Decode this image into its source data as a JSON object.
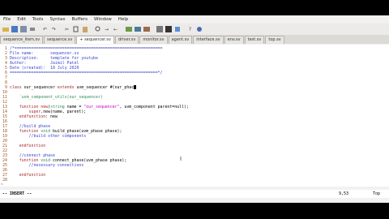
{
  "menu": [
    "File",
    "Edit",
    "Tools",
    "Syntax",
    "Buffers",
    "Window",
    "Help"
  ],
  "tabs": [
    {
      "label": "sequence_item.sv",
      "active": false
    },
    {
      "label": "sequence.sv",
      "active": false
    },
    {
      "label": "+ sequencer.sv",
      "active": true
    },
    {
      "label": "driver.sv",
      "active": false
    },
    {
      "label": "monitor.sv",
      "active": false
    },
    {
      "label": "agent.sv",
      "active": false
    },
    {
      "label": "interface.sv",
      "active": false
    },
    {
      "label": "env.sv",
      "active": false
    },
    {
      "label": "test.sv",
      "active": false
    },
    {
      "label": "top.sv",
      "active": false
    }
  ],
  "lines": [
    {
      "n": "1",
      "parts": [
        [
          "/*==============================================================",
          "com"
        ]
      ]
    },
    {
      "n": "2",
      "parts": [
        [
          "File name:       sequencer.sv",
          "com"
        ]
      ]
    },
    {
      "n": "3",
      "parts": [
        [
          "Description:     template for youtube",
          "com"
        ]
      ]
    },
    {
      "n": "4",
      "parts": [
        [
          "Author:          Jaimil Patel",
          "com"
        ]
      ]
    },
    {
      "n": "5",
      "parts": [
        [
          "Date (created):  18 July 2020",
          "com"
        ]
      ]
    },
    {
      "n": "6",
      "parts": [
        [
          "==============================================================*/",
          "com"
        ]
      ]
    },
    {
      "n": "7",
      "parts": []
    },
    {
      "n": "8",
      "parts": []
    },
    {
      "n": "9",
      "parts": [
        [
          "class ",
          "kw"
        ],
        [
          "our_sequencer ",
          "plain"
        ],
        [
          "extends ",
          "kw"
        ],
        [
          "uvm_sequencer ",
          "plain"
        ],
        [
          "#(",
          "plain"
        ],
        [
          "our_phac",
          "plain"
        ]
      ]
    },
    {
      "n": "10",
      "parts": []
    },
    {
      "n": "11",
      "parts": [
        [
          "    `uvm_component_utils(our_sequencer)",
          "cls"
        ]
      ]
    },
    {
      "n": "12",
      "parts": []
    },
    {
      "n": "13",
      "parts": [
        [
          "    function ",
          "kw"
        ],
        [
          "new",
          "kw"
        ],
        [
          "(",
          "plain"
        ],
        [
          "string ",
          "cls"
        ],
        [
          "name = ",
          "plain"
        ],
        [
          "\"our_sequencer\"",
          "str"
        ],
        [
          ", uvm_component parent=null);",
          "plain"
        ]
      ]
    },
    {
      "n": "14",
      "parts": [
        [
          "        super",
          "kw"
        ],
        [
          ".new(name, parent);",
          "plain"
        ]
      ]
    },
    {
      "n": "15",
      "parts": [
        [
          "    endfunction",
          "kw"
        ],
        [
          ": new",
          "plain"
        ]
      ]
    },
    {
      "n": "16",
      "parts": []
    },
    {
      "n": "17",
      "parts": [
        [
          "    //build phase",
          "com"
        ]
      ]
    },
    {
      "n": "18",
      "parts": [
        [
          "    function ",
          "kw"
        ],
        [
          "void ",
          "cls"
        ],
        [
          "build_phase(uvm_phase phase);",
          "plain"
        ]
      ]
    },
    {
      "n": "19",
      "parts": [
        [
          "        //build other components",
          "com"
        ]
      ]
    },
    {
      "n": "20",
      "parts": []
    },
    {
      "n": "21",
      "parts": [
        [
          "    endfunction",
          "kw"
        ]
      ]
    },
    {
      "n": "22",
      "parts": []
    },
    {
      "n": "23",
      "parts": [
        [
          "    //connect phase",
          "com"
        ]
      ]
    },
    {
      "n": "24",
      "parts": [
        [
          "    function ",
          "kw"
        ],
        [
          "void ",
          "cls"
        ],
        [
          "connect_phase(uvm_phase phase);",
          "plain"
        ]
      ]
    },
    {
      "n": "25",
      "parts": [
        [
          "        //necessary connections",
          "com"
        ]
      ]
    },
    {
      "n": "26",
      "parts": []
    },
    {
      "n": "27",
      "parts": [
        [
          "    endfunction",
          "kw"
        ]
      ]
    },
    {
      "n": "28",
      "parts": []
    }
  ],
  "tilde_rows": [
    "~"
  ],
  "status": {
    "mode": "-- INSERT --",
    "position": "9,53",
    "percent": "Top"
  }
}
